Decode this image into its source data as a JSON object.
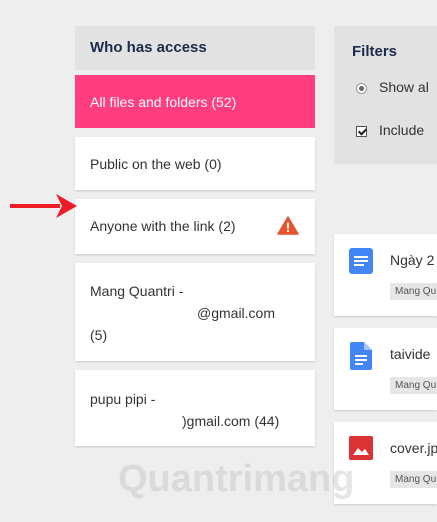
{
  "access": {
    "header": "Who has access",
    "items": [
      {
        "line1": "All files and folders (52)"
      },
      {
        "line1": "Public on the web (0)"
      },
      {
        "line1": "Anyone with the link (2)"
      },
      {
        "line1": "Mang Quantri -",
        "line2": "@gmail.com",
        "line3": "(5)"
      },
      {
        "line1": "pupu pipi -",
        "line2": ")gmail.com (44)"
      }
    ]
  },
  "filters": {
    "title": "Filters",
    "show_label": "Show al",
    "include_label": "Include"
  },
  "files": [
    {
      "name": "Ngày 2",
      "owner": "Mang Qu"
    },
    {
      "name": "taivide",
      "owner": "Mang Qu"
    },
    {
      "name": "cover.jp",
      "owner": "Mang Qu"
    }
  ],
  "watermark": "Quantrimang",
  "colors": {
    "active": "#ff3d7f",
    "warning": "#e8532b",
    "arrow": "#ee1c25",
    "doc_blue": "#4285f4",
    "image_red": "#db3236"
  }
}
